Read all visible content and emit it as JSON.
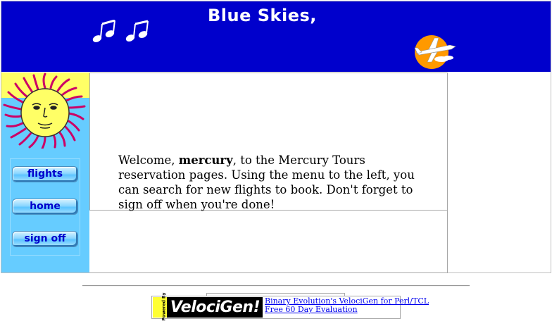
{
  "banner": {
    "title": "Blue Skies,",
    "background": "#0000cc"
  },
  "sidebar": {
    "background": "#66ccff",
    "buttons": [
      {
        "label": "flights"
      },
      {
        "label": "home"
      },
      {
        "label": "sign off"
      }
    ]
  },
  "content": {
    "welcome_prefix": "Welcome, ",
    "username": "mercury",
    "welcome_suffix": ", to the Mercury Tours reservation pages. Using the menu to the left, you can search for new flights to book. Don't forget to sign off when you're done!"
  },
  "footer": {
    "powered_by": "Powered By",
    "logo_text": "VelociGen!",
    "link1": "Binary Evolution's VelociGen for Perl/TCL",
    "link2": "Free 60 Day Evaluation"
  }
}
